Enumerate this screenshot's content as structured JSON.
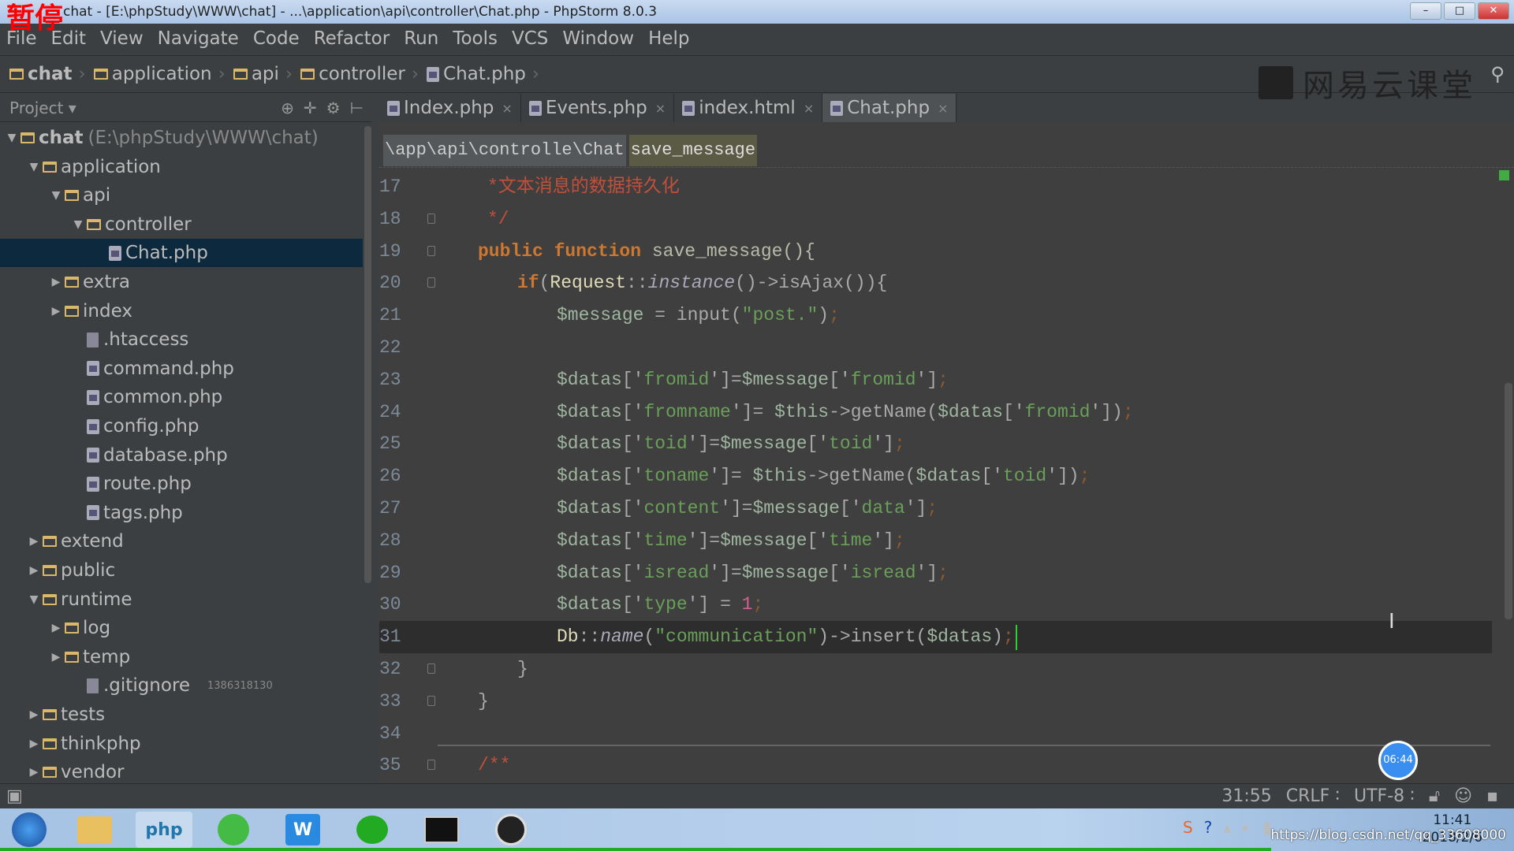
{
  "overlay": {
    "pause_label": "暂停",
    "timer": "06:44"
  },
  "window": {
    "title": "chat - [E:\\phpStudy\\WWW\\chat] - ...\\application\\api\\controller\\Chat.php - PhpStorm 8.0.3"
  },
  "menu": [
    "File",
    "Edit",
    "View",
    "Navigate",
    "Code",
    "Refactor",
    "Run",
    "Tools",
    "VCS",
    "Window",
    "Help"
  ],
  "breadcrumb": [
    {
      "label": "chat",
      "icon": "folder-icon"
    },
    {
      "label": "application",
      "icon": "folder-icon"
    },
    {
      "label": "api",
      "icon": "folder-icon"
    },
    {
      "label": "controller",
      "icon": "folder-icon"
    },
    {
      "label": "Chat.php",
      "icon": "php-file-icon"
    }
  ],
  "watermark": "网易云课堂",
  "project": {
    "label": "Project"
  },
  "tabs": [
    {
      "label": "Index.php",
      "active": false
    },
    {
      "label": "Events.php",
      "active": false
    },
    {
      "label": "index.html",
      "active": false
    },
    {
      "label": "Chat.php",
      "active": true
    }
  ],
  "tree": [
    {
      "label": "chat",
      "extra": "(E:\\phpStudy\\WWW\\chat)",
      "depth": 0,
      "type": "folder",
      "arrow": "down",
      "bold": true
    },
    {
      "label": "application",
      "depth": 1,
      "type": "folder",
      "arrow": "down"
    },
    {
      "label": "api",
      "depth": 2,
      "type": "folder",
      "arrow": "down"
    },
    {
      "label": "controller",
      "depth": 3,
      "type": "folder",
      "arrow": "down"
    },
    {
      "label": "Chat.php",
      "depth": 4,
      "type": "php",
      "selected": true
    },
    {
      "label": "extra",
      "depth": 2,
      "type": "folder",
      "arrow": "right"
    },
    {
      "label": "index",
      "depth": 2,
      "type": "folder",
      "arrow": "right"
    },
    {
      "label": ".htaccess",
      "depth": 3,
      "type": "file"
    },
    {
      "label": "command.php",
      "depth": 3,
      "type": "php"
    },
    {
      "label": "common.php",
      "depth": 3,
      "type": "php"
    },
    {
      "label": "config.php",
      "depth": 3,
      "type": "php"
    },
    {
      "label": "database.php",
      "depth": 3,
      "type": "php"
    },
    {
      "label": "route.php",
      "depth": 3,
      "type": "php"
    },
    {
      "label": "tags.php",
      "depth": 3,
      "type": "php"
    },
    {
      "label": "extend",
      "depth": 1,
      "type": "folder",
      "arrow": "right"
    },
    {
      "label": "public",
      "depth": 1,
      "type": "folder",
      "arrow": "right"
    },
    {
      "label": "runtime",
      "depth": 1,
      "type": "folder",
      "arrow": "down"
    },
    {
      "label": "log",
      "depth": 2,
      "type": "folder",
      "arrow": "right"
    },
    {
      "label": "temp",
      "depth": 2,
      "type": "folder",
      "arrow": "right"
    },
    {
      "label": ".gitignore",
      "depth": 3,
      "type": "file",
      "note": "1386318130"
    },
    {
      "label": "tests",
      "depth": 1,
      "type": "folder",
      "arrow": "right"
    },
    {
      "label": "thinkphp",
      "depth": 1,
      "type": "folder",
      "arrow": "right"
    },
    {
      "label": "vendor",
      "depth": 1,
      "type": "folder",
      "arrow": "right"
    }
  ],
  "editor": {
    "breadcrumb_path": "\\app\\api\\controlle\\Chat",
    "breadcrumb_method": "save_message",
    "lines": [
      {
        "num": "17",
        "indent": 1,
        "tokens": [
          [
            "cm",
            "*文本消息的数据持久化"
          ]
        ]
      },
      {
        "num": "18",
        "indent": 1,
        "fold": true,
        "tokens": [
          [
            "cm",
            "*/"
          ]
        ]
      },
      {
        "num": "19",
        "indent": 1,
        "fold": true,
        "tokens": [
          [
            "kw",
            "public function "
          ],
          [
            "fn",
            "save_message(){"
          ]
        ]
      },
      {
        "num": "20",
        "indent": 2,
        "fold": true,
        "tokens": [
          [
            "kw",
            "if"
          ],
          [
            "pu",
            "("
          ],
          [
            "cls",
            "Request"
          ],
          [
            "pu",
            "::"
          ],
          [
            "it",
            "instance"
          ],
          [
            "pu",
            "()->isAjax()){"
          ]
        ]
      },
      {
        "num": "21",
        "indent": 3,
        "tokens": [
          [
            "var",
            "$message"
          ],
          [
            "pu",
            " = input("
          ],
          [
            "str",
            "\"post.\""
          ],
          [
            "pu",
            ")"
          ],
          [
            "semi",
            ";"
          ]
        ]
      },
      {
        "num": "22",
        "indent": 3,
        "tokens": []
      },
      {
        "num": "23",
        "indent": 3,
        "tokens": [
          [
            "var",
            "$datas"
          ],
          [
            "pu",
            "['"
          ],
          [
            "str",
            "fromid"
          ],
          [
            "pu",
            "']="
          ],
          [
            "var",
            "$message"
          ],
          [
            "pu",
            "['"
          ],
          [
            "str",
            "fromid"
          ],
          [
            "pu",
            "']"
          ],
          [
            "semi",
            ";"
          ]
        ]
      },
      {
        "num": "24",
        "indent": 3,
        "tokens": [
          [
            "var",
            "$datas"
          ],
          [
            "pu",
            "['"
          ],
          [
            "str",
            "fromname"
          ],
          [
            "pu",
            "']= "
          ],
          [
            "var",
            "$this"
          ],
          [
            "pu",
            "->getName("
          ],
          [
            "var",
            "$datas"
          ],
          [
            "pu",
            "['"
          ],
          [
            "str",
            "fromid"
          ],
          [
            "pu",
            "'])"
          ],
          [
            "semi",
            ";"
          ]
        ]
      },
      {
        "num": "25",
        "indent": 3,
        "tokens": [
          [
            "var",
            "$datas"
          ],
          [
            "pu",
            "['"
          ],
          [
            "str",
            "toid"
          ],
          [
            "pu",
            "']="
          ],
          [
            "var",
            "$message"
          ],
          [
            "pu",
            "['"
          ],
          [
            "str",
            "toid"
          ],
          [
            "pu",
            "']"
          ],
          [
            "semi",
            ";"
          ]
        ]
      },
      {
        "num": "26",
        "indent": 3,
        "tokens": [
          [
            "var",
            "$datas"
          ],
          [
            "pu",
            "['"
          ],
          [
            "str",
            "toname"
          ],
          [
            "pu",
            "']= "
          ],
          [
            "var",
            "$this"
          ],
          [
            "pu",
            "->getName("
          ],
          [
            "var",
            "$datas"
          ],
          [
            "pu",
            "['"
          ],
          [
            "str",
            "toid"
          ],
          [
            "pu",
            "'])"
          ],
          [
            "semi",
            ";"
          ]
        ]
      },
      {
        "num": "27",
        "indent": 3,
        "tokens": [
          [
            "var",
            "$datas"
          ],
          [
            "pu",
            "['"
          ],
          [
            "str",
            "content"
          ],
          [
            "pu",
            "']="
          ],
          [
            "var",
            "$message"
          ],
          [
            "pu",
            "['"
          ],
          [
            "str",
            "data"
          ],
          [
            "pu",
            "']"
          ],
          [
            "semi",
            ";"
          ]
        ]
      },
      {
        "num": "28",
        "indent": 3,
        "tokens": [
          [
            "var",
            "$datas"
          ],
          [
            "pu",
            "['"
          ],
          [
            "str",
            "time"
          ],
          [
            "pu",
            "']="
          ],
          [
            "var",
            "$message"
          ],
          [
            "pu",
            "['"
          ],
          [
            "str",
            "time"
          ],
          [
            "pu",
            "']"
          ],
          [
            "semi",
            ";"
          ]
        ]
      },
      {
        "num": "29",
        "indent": 3,
        "tokens": [
          [
            "var",
            "$datas"
          ],
          [
            "pu",
            "['"
          ],
          [
            "str",
            "isread"
          ],
          [
            "pu",
            "']="
          ],
          [
            "var",
            "$message"
          ],
          [
            "pu",
            "['"
          ],
          [
            "str",
            "isread"
          ],
          [
            "pu",
            "']"
          ],
          [
            "semi",
            ";"
          ]
        ]
      },
      {
        "num": "30",
        "indent": 3,
        "tokens": [
          [
            "var",
            "$datas"
          ],
          [
            "pu",
            "['"
          ],
          [
            "str",
            "type"
          ],
          [
            "pu",
            "'] = "
          ],
          [
            "num",
            "1"
          ],
          [
            "semi",
            ";"
          ]
        ]
      },
      {
        "num": "31",
        "indent": 3,
        "current": true,
        "tokens": [
          [
            "cls",
            "Db"
          ],
          [
            "pu",
            "::"
          ],
          [
            "it",
            "name"
          ],
          [
            "pu",
            "("
          ],
          [
            "str",
            "\"communication\""
          ],
          [
            "pu",
            ")->insert("
          ],
          [
            "var",
            "$datas"
          ],
          [
            "pu",
            ")"
          ],
          [
            "semi",
            ";"
          ]
        ]
      },
      {
        "num": "32",
        "indent": 2,
        "fold": true,
        "tokens": [
          [
            "pu",
            "}"
          ]
        ]
      },
      {
        "num": "33",
        "indent": 1,
        "fold": true,
        "tokens": [
          [
            "pu",
            "}"
          ]
        ]
      },
      {
        "num": "34",
        "indent": 1,
        "tokens": []
      },
      {
        "num": "35",
        "indent": 1,
        "fold": true,
        "tokens": [
          [
            "cm",
            "/**"
          ]
        ]
      }
    ]
  },
  "status": {
    "position": "31:55",
    "line_sep": "CRLF ∶",
    "encoding": "UTF-8 ∶"
  },
  "taskbar": {
    "clock_time": "11:41",
    "clock_date": "2018/2/6",
    "url_watermark": "https://blog.csdn.net/qq_33608000"
  }
}
